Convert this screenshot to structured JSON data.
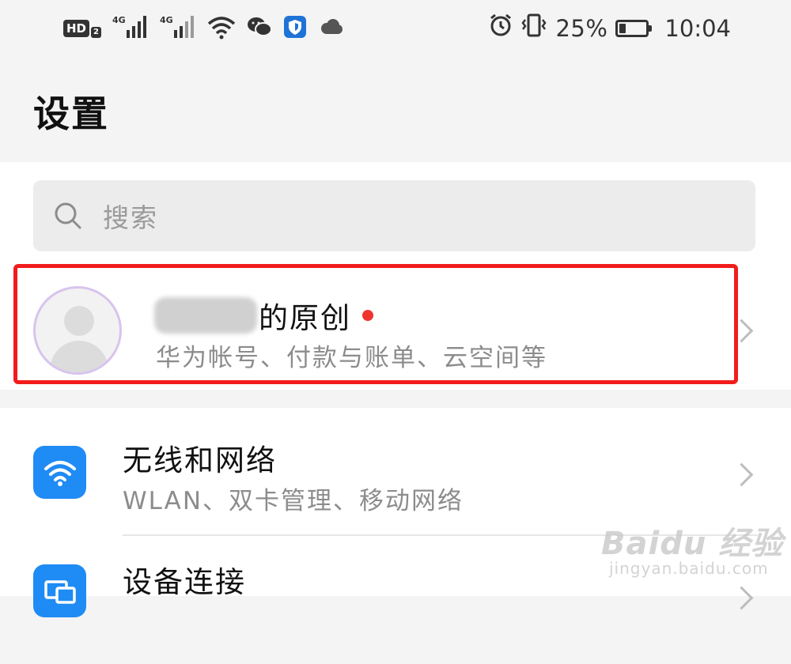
{
  "status_bar": {
    "hd_label": "HD",
    "hd_sub": "2",
    "network1": "4G",
    "network2": "4G",
    "battery_percent": "25%",
    "battery_level": 0.25,
    "time": "10:04",
    "icons": [
      "hd-icon",
      "signal-icon",
      "signal-icon",
      "wifi-icon",
      "wechat-icon",
      "shield-app-icon",
      "cloud-icon",
      "alarm-icon",
      "vibrate-icon",
      "battery-icon"
    ]
  },
  "header": {
    "title": "设置"
  },
  "search": {
    "placeholder": "搜索"
  },
  "account": {
    "name_suffix": "的原创",
    "subtitle": "华为帐号、付款与账单、云空间等",
    "highlight_color": "#f21c1c"
  },
  "menu": [
    {
      "icon": "wifi-icon",
      "title": "无线和网络",
      "subtitle": "WLAN、双卡管理、移动网络"
    },
    {
      "icon": "device-connect-icon",
      "title": "设备连接",
      "subtitle": ""
    }
  ],
  "colors": {
    "accent": "#1f8bf5",
    "notification_dot": "#f0322e"
  },
  "watermark": {
    "brand": "Baidu 经验",
    "url": "jingyan.baidu.com"
  }
}
